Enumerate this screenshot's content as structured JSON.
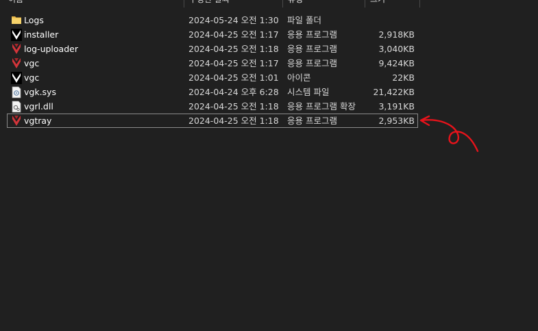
{
  "columns": {
    "name": "이름",
    "date": "수정한 날짜",
    "type": "유형",
    "size": "크기"
  },
  "files": [
    {
      "name": "Logs",
      "date": "2024-05-24 오전 1:30",
      "type": "파일 폴더",
      "size": "",
      "icon": "folder-icon"
    },
    {
      "name": "installer",
      "date": "2024-04-25 오전 1:17",
      "type": "응용 프로그램",
      "size": "2,918KB",
      "icon": "vanguard-app-icon"
    },
    {
      "name": "log-uploader",
      "date": "2024-04-25 오전 1:18",
      "type": "응용 프로그램",
      "size": "3,040KB",
      "icon": "vanguard-red-icon"
    },
    {
      "name": "vgc",
      "date": "2024-04-25 오전 1:17",
      "type": "응용 프로그램",
      "size": "9,424KB",
      "icon": "vanguard-red-icon"
    },
    {
      "name": "vgc",
      "date": "2024-04-25 오전 1:01",
      "type": "아이콘",
      "size": "22KB",
      "icon": "vanguard-app-icon"
    },
    {
      "name": "vgk.sys",
      "date": "2024-04-24 오후 6:28",
      "type": "시스템 파일",
      "size": "21,422KB",
      "icon": "system-file-icon"
    },
    {
      "name": "vgrl.dll",
      "date": "2024-04-25 오전 1:18",
      "type": "응용 프로그램 확장",
      "size": "3,191KB",
      "icon": "dll-file-icon"
    },
    {
      "name": "vgtray",
      "date": "2024-04-25 오전 1:18",
      "type": "응용 프로그램",
      "size": "2,953KB",
      "icon": "vanguard-red-icon",
      "selected": true
    }
  ],
  "colors": {
    "background": "#202020",
    "selection_border": "#8a8a8a",
    "annotation": "#e8131b",
    "vanguard_red": "#d3343a",
    "folder_yellow": "#f2c94c"
  }
}
